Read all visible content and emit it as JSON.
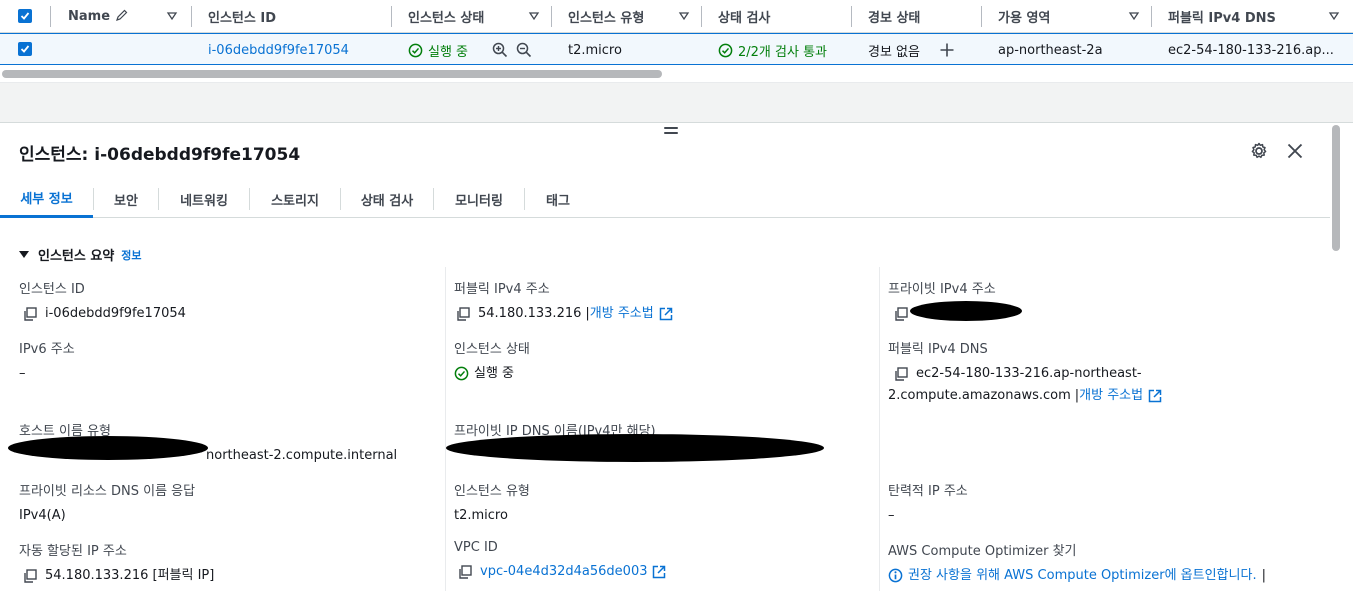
{
  "table": {
    "headers": {
      "name": "Name",
      "instance_id": "인스턴스 ID",
      "instance_state": "인스턴스 상태",
      "instance_type": "인스턴스 유형",
      "status_check": "상태 검사",
      "alarm_status": "경보 상태",
      "availability_zone": "가용 영역",
      "public_ipv4_dns": "퍼블릭 IPv4 DNS"
    },
    "row": {
      "name": "",
      "instance_id": "i-06debdd9f9fe17054",
      "instance_state": "실행 중",
      "instance_type": "t2.micro",
      "status_check": "2/2개 검사 통과",
      "alarm_status": "경보 없음",
      "availability_zone": "ap-northeast-2a",
      "public_ipv4_dns": "ec2-54-180-133-216.ap..."
    }
  },
  "panel": {
    "title": "인스턴스: i-06debdd9f9fe17054",
    "tabs": [
      "세부 정보",
      "보안",
      "네트워킹",
      "스토리지",
      "상태 검사",
      "모니터링",
      "태그"
    ],
    "active_tab": "세부 정보",
    "section_title": "인스턴스 요약",
    "section_info": "정보",
    "fields": {
      "instance_id": {
        "label": "인스턴스 ID",
        "value": "i-06debdd9f9fe17054"
      },
      "public_ipv4": {
        "label": "퍼블릭 IPv4 주소",
        "value": "54.180.133.216",
        "link": "개방 주소법"
      },
      "private_ipv4": {
        "label": "프라이빗 IPv4 주소",
        "value": ""
      },
      "ipv6": {
        "label": "IPv6 주소",
        "value": "–"
      },
      "instance_state": {
        "label": "인스턴스 상태",
        "value": "실행 중"
      },
      "public_dns": {
        "label": "퍼블릭 IPv4 DNS",
        "value_line1": "ec2-54-180-133-216.ap-northeast-",
        "value_line2": "2.compute.amazonaws.com",
        "link": "개방 주소법"
      },
      "hostname_type": {
        "label": "호스트 이름 유형",
        "value": "northeast-2.compute.internal"
      },
      "private_ip_dns": {
        "label": "프라이빗 IP DNS 이름(IPv4만 해당)",
        "value": ""
      },
      "private_resource_dns": {
        "label": "프라이빗 리소스 DNS 이름 응답",
        "value": "IPv4(A)"
      },
      "instance_type": {
        "label": "인스턴스 유형",
        "value": "t2.micro"
      },
      "elastic_ip": {
        "label": "탄력적 IP 주소",
        "value": "–"
      },
      "auto_ip": {
        "label": "자동 할당된 IP 주소",
        "value": "54.180.133.216 [퍼블릭 IP]"
      },
      "vpc_id": {
        "label": "VPC ID",
        "value": "vpc-04e4d32d4a56de003"
      },
      "compute_optimizer": {
        "label": "AWS Compute Optimizer 찾기",
        "value": "권장 사항을 위해 AWS Compute Optimizer에 옵트인합니다.",
        "separator": "|"
      }
    }
  },
  "colors": {
    "accent": "#0972d3",
    "success": "#037f0c",
    "text": "#16191f",
    "muted": "#414750"
  }
}
